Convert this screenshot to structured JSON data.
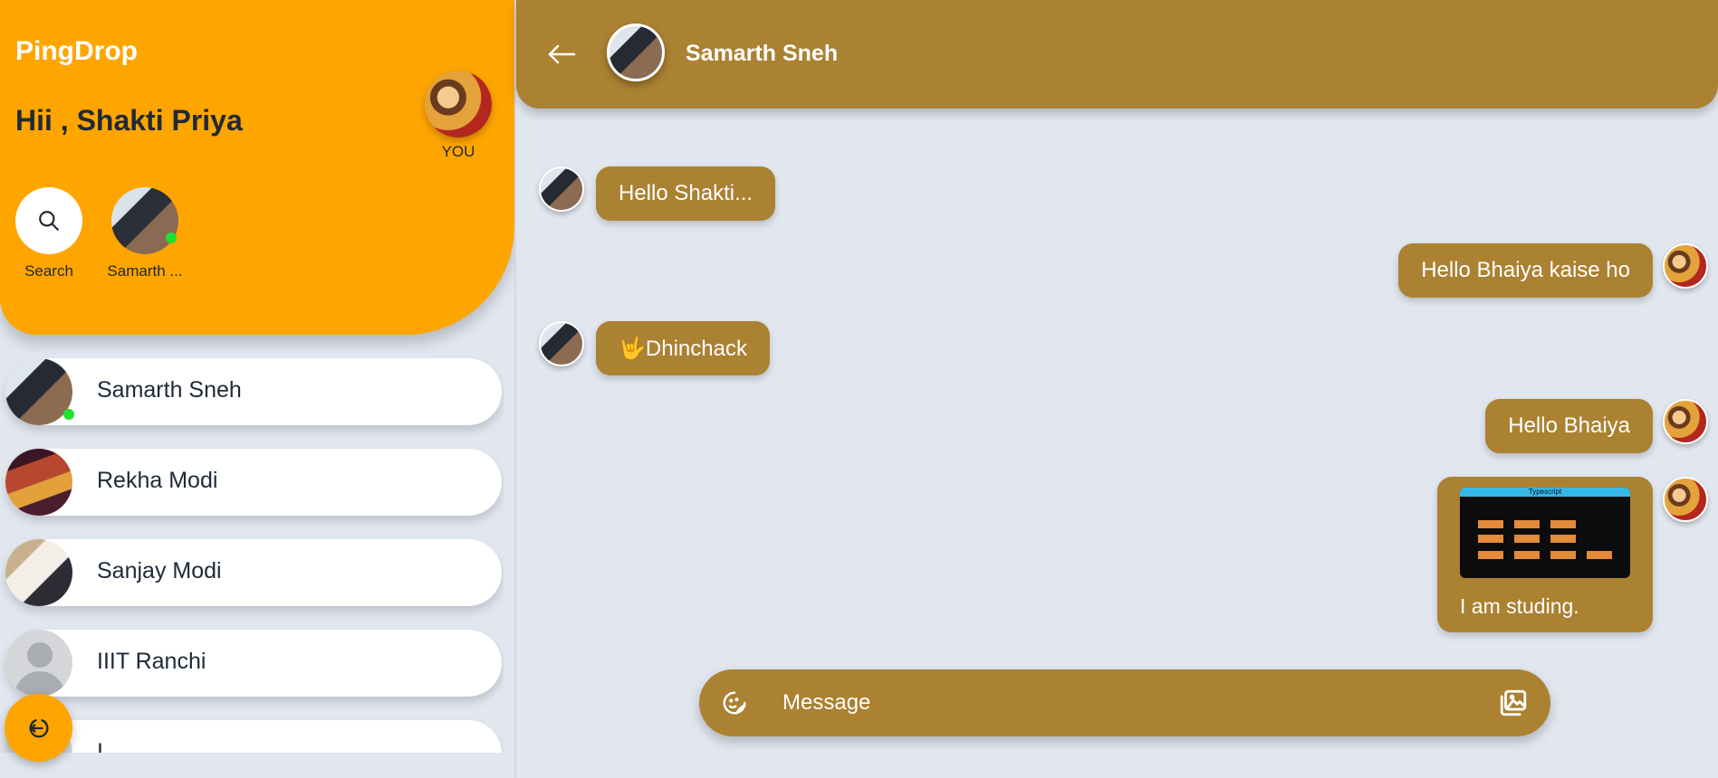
{
  "app": {
    "brand": "PingDrop",
    "greeting": "Hii , Shakti Priya"
  },
  "me": {
    "label": "YOU"
  },
  "stories": [
    {
      "label": "Search",
      "icon": "search-icon"
    },
    {
      "label": "Samarth ...",
      "online": true
    }
  ],
  "contacts": [
    {
      "name": "Samarth Sneh",
      "online": true
    },
    {
      "name": "Rekha Modi"
    },
    {
      "name": "Sanjay Modi"
    },
    {
      "name": "IIIT Ranchi"
    },
    {
      "name": "I"
    }
  ],
  "chat": {
    "contact_name": "Samarth Sneh",
    "messages": [
      {
        "from": "them",
        "text": "Hello Shakti..."
      },
      {
        "from": "me",
        "text": "Hello Bhaiya kaise ho"
      },
      {
        "from": "them",
        "text": "🤟Dhinchack"
      },
      {
        "from": "me",
        "text": "Hello Bhaiya"
      },
      {
        "from": "me",
        "image": true,
        "image_title": "Typescript",
        "text": "I am studing."
      }
    ]
  },
  "composer": {
    "placeholder": "Message"
  },
  "icons": {
    "back": "arrow-left-icon",
    "emoji": "emoji-icon",
    "attach": "image-attach-icon",
    "logout": "logout-icon"
  },
  "colors": {
    "sidebar_accent": "#ffa500",
    "chat_accent": "#ab8132",
    "background": "#e1e6ef",
    "online": "#22e030"
  }
}
